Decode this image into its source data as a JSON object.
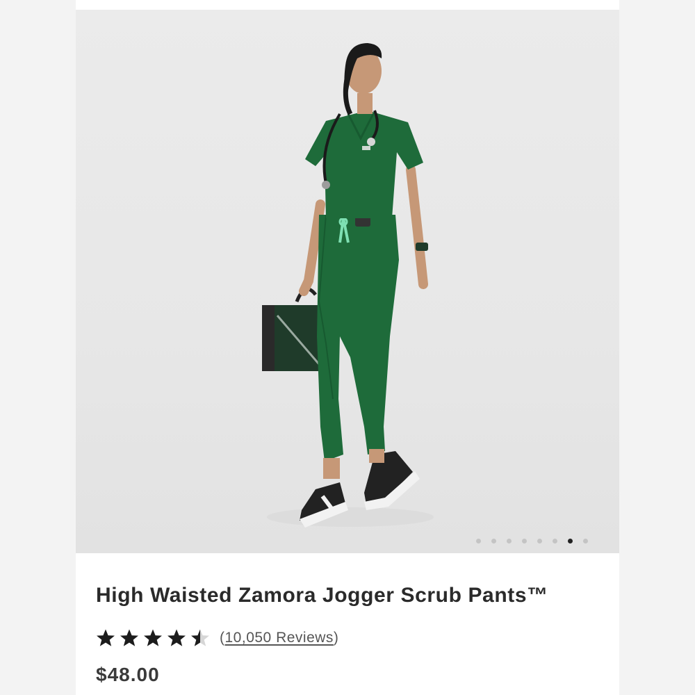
{
  "product": {
    "title": "High Waisted Zamora Jogger Scrub Pants™",
    "image_alt": "Model wearing green jogger scrub pants with stethoscope and bag",
    "rating": {
      "value": 4.5,
      "max": 5,
      "reviews_open": "(",
      "reviews_text": "10,050 Reviews",
      "reviews_close": ")"
    },
    "price": "$48.00"
  },
  "carousel": {
    "count": 8,
    "active_index": 6
  },
  "colors": {
    "scrub_green": "#1e6b3a",
    "drawstring_mint": "#7fe0b3",
    "star_filled": "#1c1c1c",
    "star_empty": "#d6d6d6",
    "dot_inactive": "#c4c4c4",
    "dot_active": "#222222"
  }
}
